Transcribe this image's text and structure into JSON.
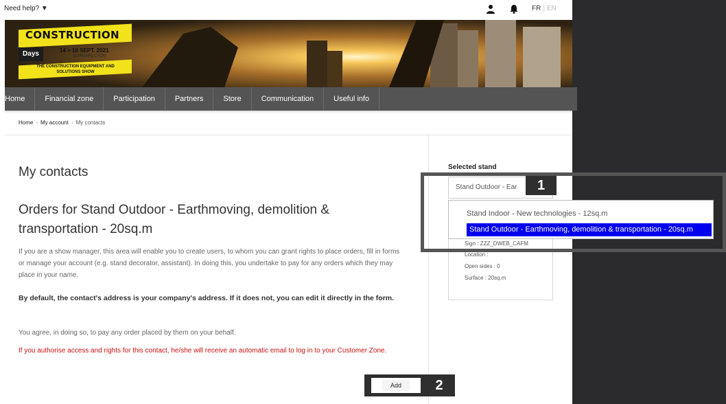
{
  "topbar": {
    "help": "Need help? ▼",
    "lang_fr": "FR",
    "lang_sep": "|",
    "lang_en": "EN"
  },
  "banner": {
    "title": "CONSTRUCTION",
    "days": "Days",
    "dates": "14 > 16 SEPT. 2021",
    "venue": "EUREXPO LYON",
    "subtitle": "THE CONSTRUCTION EQUIPMENT AND SOLUTIONS SHOW"
  },
  "nav": {
    "items": [
      {
        "label": "Home"
      },
      {
        "label": "Financial zone"
      },
      {
        "label": "Participation"
      },
      {
        "label": "Partners"
      },
      {
        "label": "Store"
      },
      {
        "label": "Communication"
      },
      {
        "label": "Useful info"
      }
    ]
  },
  "breadcrumb": {
    "home": "Home",
    "account": "My account",
    "current": "My contacts",
    "sep": "›"
  },
  "main": {
    "heading": "My contacts",
    "orders_heading": "Orders for Stand Outdoor - Earthmoving, demolition & transportation - 20sq.m",
    "p1": "If you are a show manager, this area will enable you to create users, to whom you can grant rights to place orders, fill in forms or manage your account (e.g. stand decorator, assistant). In doing this, you undertake to pay for any orders which they may place in your name.",
    "p2": "By default, the contact's address is your company's address. If it does not, you can edit it directly in the form.",
    "p3": "You agree, in doing so, to pay any order placed by them on your behalf.",
    "p4": "If you authorise access and rights for this contact, he/she will receive an automatic email to log in to your Customer Zone.",
    "add_label": "Add"
  },
  "sidebar": {
    "selected_label": "Selected stand",
    "select_value": "Stand Outdoor - Ear",
    "options": [
      {
        "label": "Stand Indoor - New technologies - 12sq.m",
        "selected": false
      },
      {
        "label": "Stand Outdoor - Earthmoving, demolition & transportation - 20sq.m",
        "selected": true
      }
    ],
    "info": {
      "sign": "Sign : ZZZ_DWEB_CAFM",
      "location": "Location :",
      "open_sides": "Open sides : 0",
      "surface": "Surface : 20sq.m"
    }
  },
  "annotations": {
    "badge1": "1",
    "badge2": "2"
  },
  "colors": {
    "nav_bg": "#545454",
    "highlight": "#0000ee",
    "warning_text": "#cc1111",
    "brand_yellow": "#f2e21b",
    "annotation_dark": "#2f2f2f"
  },
  "icons": {
    "user": "user-icon",
    "bell": "bell-icon"
  }
}
